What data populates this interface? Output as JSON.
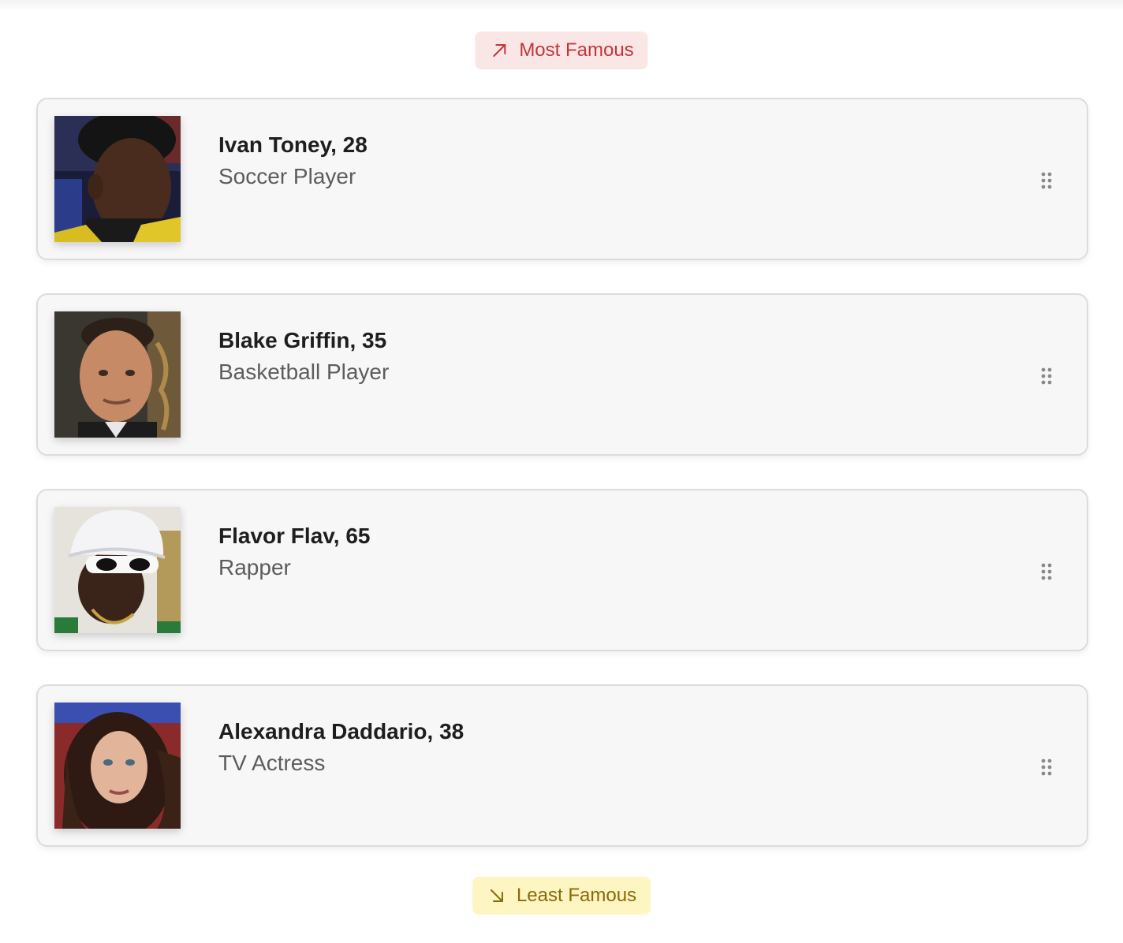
{
  "header": {
    "most_label": "Most Famous",
    "most_icon": "arrow-up-right-icon",
    "most_color": "#c0363a",
    "most_bg": "#fbe6e6"
  },
  "footer": {
    "least_label": "Least Famous",
    "least_icon": "arrow-down-right-icon",
    "least_color": "#8a6a08",
    "least_bg": "#fdf5c2"
  },
  "cards": [
    {
      "name": "Ivan Toney, 28",
      "role": "Soccer Player",
      "photo": "portrait-photo"
    },
    {
      "name": "Blake Griffin, 35",
      "role": "Basketball Player",
      "photo": "portrait-photo"
    },
    {
      "name": "Flavor Flav, 65",
      "role": "Rapper",
      "photo": "portrait-photo"
    },
    {
      "name": "Alexandra Daddario, 38",
      "role": "TV Actress",
      "photo": "portrait-photo"
    }
  ],
  "drag_handle_icon": "drag-handle-icon"
}
